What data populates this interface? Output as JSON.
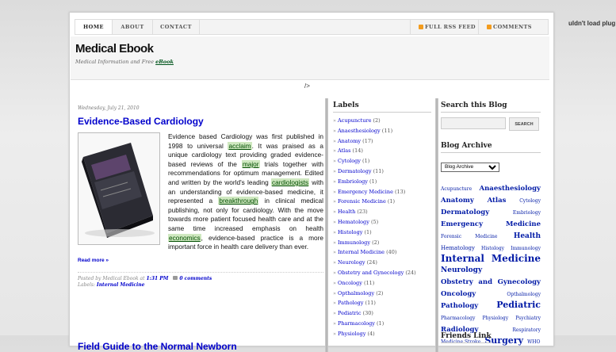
{
  "plugin_message": "uldn't load plug",
  "nav": {
    "tabs": [
      "HOME",
      "ABOUT",
      "CONTACT"
    ],
    "rss": "FULL RSS FEED",
    "comments": "COMMENTS FEED"
  },
  "header": {
    "title": "Medical Ebook",
    "description_prefix": "Medical Information and Free ",
    "description_link": "eBook"
  },
  "stray_text": "/>",
  "post": {
    "date": "Wednesday, July 21, 2010",
    "title": "Evidence-Based Cardiology",
    "body": [
      {
        "t": "Evidence based Cardiology was first published in 1998 to universal "
      },
      {
        "t": "acclaim",
        "link": true
      },
      {
        "t": ". It was praised as a unique cardiology text providing graded evidence-based reviews of the "
      },
      {
        "t": "major",
        "link": true
      },
      {
        "t": " trials together with recommendations for optimum management. Edited and written by the world's leading "
      },
      {
        "t": "cardiologists",
        "link": true
      },
      {
        "t": " with an understanding of evidence-based medicine, it represented a "
      },
      {
        "t": "breakthrough",
        "link": true
      },
      {
        "t": " in clinical medical publishing, not only for cardiology. With the move towards more patient focused health care and at the same time increased emphasis on health "
      },
      {
        "t": "economics",
        "link": true
      },
      {
        "t": ", evidence-based practice is a more important force in health care delivery than ever."
      }
    ],
    "read_more": "Read more »",
    "posted_by": "Posted by Medical Ebook at ",
    "time": "1:31 PM",
    "comments": "0 comments",
    "labels_prefix": "Labels: ",
    "label": "Internal Medicine"
  },
  "next_post_title": "Field Guide to the Normal Newborn",
  "labels_widget": {
    "title": "Labels",
    "items": [
      {
        "name": "Acupuncture",
        "count": "(2)"
      },
      {
        "name": "Anaesthesiology",
        "count": "(11)"
      },
      {
        "name": "Anatomy",
        "count": "(17)"
      },
      {
        "name": "Atlas",
        "count": "(14)"
      },
      {
        "name": "Cytology",
        "count": "(1)"
      },
      {
        "name": "Dermatology",
        "count": "(11)"
      },
      {
        "name": "Embriology",
        "count": "(1)"
      },
      {
        "name": "Emergency Medicine",
        "count": "(13)"
      },
      {
        "name": "Forensic Medicine",
        "count": "(1)"
      },
      {
        "name": "Health",
        "count": "(23)"
      },
      {
        "name": "Hematology",
        "count": "(5)"
      },
      {
        "name": "Histology",
        "count": "(1)"
      },
      {
        "name": "Immunology",
        "count": "(2)"
      },
      {
        "name": "Internal Medicine",
        "count": "(40)"
      },
      {
        "name": "Neurology",
        "count": "(24)"
      },
      {
        "name": "Obstetry and Gynecology",
        "count": "(24)"
      },
      {
        "name": "Oncology",
        "count": "(11)"
      },
      {
        "name": "Opthalmology",
        "count": "(2)"
      },
      {
        "name": "Pathology",
        "count": "(11)"
      },
      {
        "name": "Pediatric",
        "count": "(30)"
      },
      {
        "name": "Pharmacology",
        "count": "(1)"
      },
      {
        "name": "Physiology",
        "count": "(4)"
      }
    ]
  },
  "search_widget": {
    "title": "Search this Blog",
    "button": "SEARCH"
  },
  "archive_widget": {
    "title": "Blog Archive",
    "select": "Blog Archive"
  },
  "cloud": [
    {
      "name": "Acupuncture",
      "size": 6
    },
    {
      "name": "Anaesthesiology",
      "size": 8.5
    },
    {
      "name": "Anatomy",
      "size": 8.5
    },
    {
      "name": "Atlas",
      "size": 8.5
    },
    {
      "name": "Cytology",
      "size": 6
    },
    {
      "name": "Dermatology",
      "size": 8.5
    },
    {
      "name": "Embriology",
      "size": 6
    },
    {
      "name": "Emergency Medicine",
      "size": 8.5
    },
    {
      "name": "Forensic Medicine",
      "size": 6
    },
    {
      "name": "Health",
      "size": 9
    },
    {
      "name": "Hematology",
      "size": 7
    },
    {
      "name": "Histology",
      "size": 6
    },
    {
      "name": "Immunology",
      "size": 6
    },
    {
      "name": "Internal Medicine",
      "size": 12
    },
    {
      "name": "Neurology",
      "size": 9
    },
    {
      "name": "Obstetry and Gynecology",
      "size": 8.5
    },
    {
      "name": "Oncology",
      "size": 8.5
    },
    {
      "name": "Opthalmology",
      "size": 6
    },
    {
      "name": "Pathology",
      "size": 8.5
    },
    {
      "name": "Pediatric",
      "size": 11
    },
    {
      "name": "Pharmacology",
      "size": 6
    },
    {
      "name": "Physiology",
      "size": 6
    },
    {
      "name": "Psychiatry",
      "size": 6
    },
    {
      "name": "Radiology",
      "size": 8.5
    },
    {
      "name": "Respiratory",
      "size": 6
    },
    {
      "name": "Medicine Stroke",
      "size": 6
    },
    {
      "name": "Surgery",
      "size": 11
    },
    {
      "name": "WHO",
      "size": 6
    }
  ],
  "friends_widget": {
    "title": "Friends Link"
  }
}
